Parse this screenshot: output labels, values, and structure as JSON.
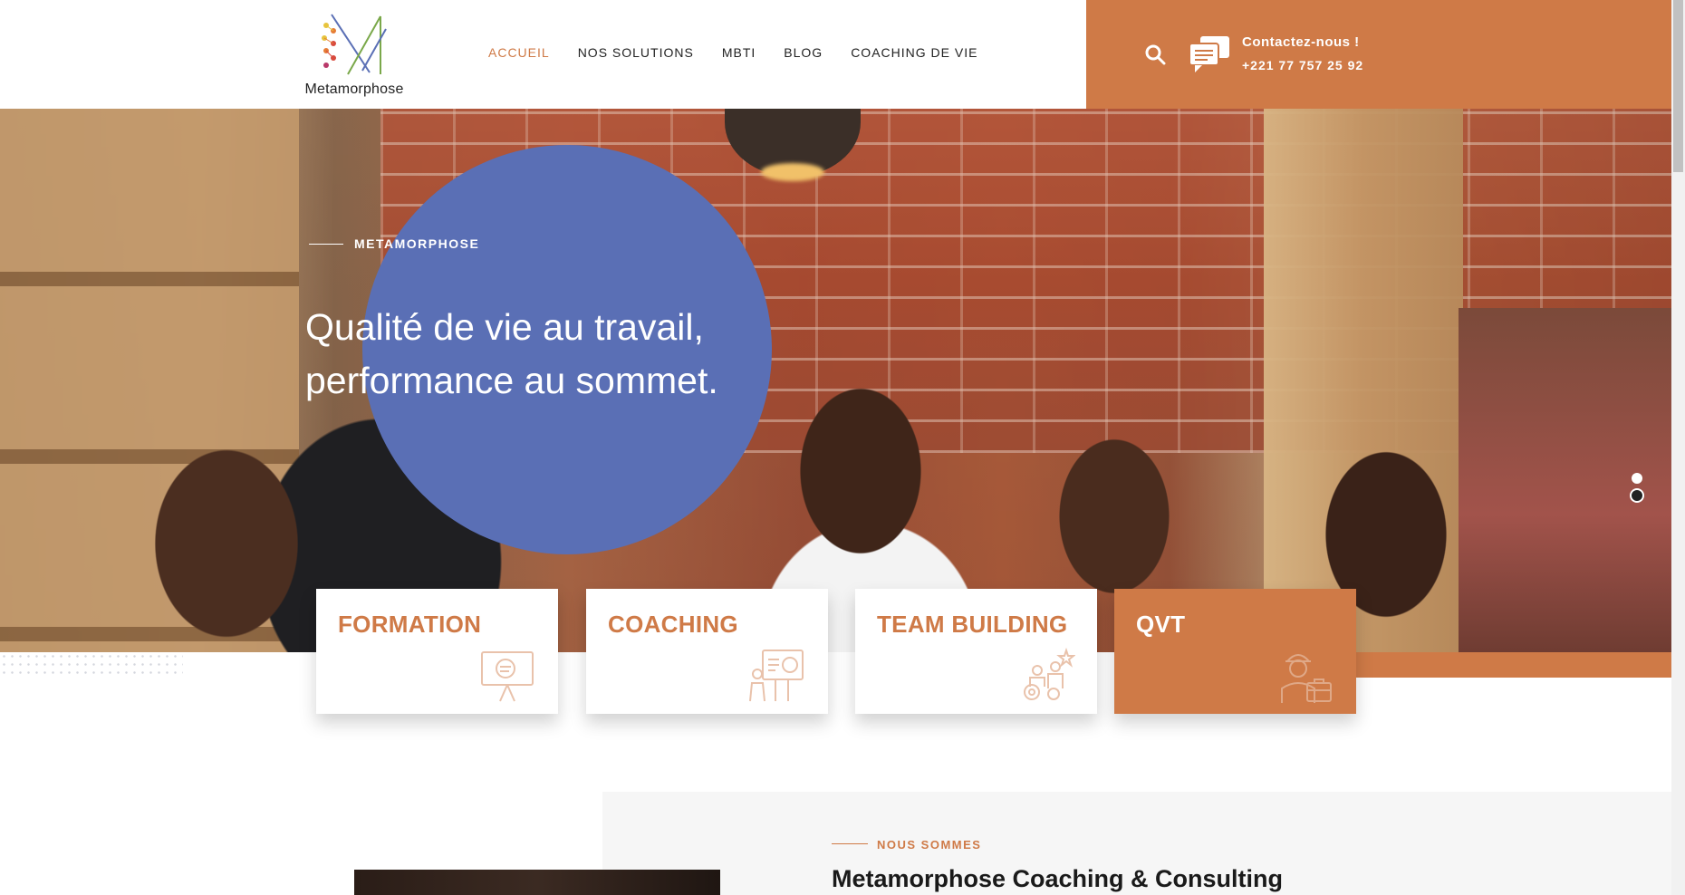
{
  "brand": {
    "logo_text": "Metamorphose",
    "accent_color": "#cf7a47",
    "circle_color": "#5a6fb5"
  },
  "nav": {
    "items": [
      {
        "label": "ACCUEIL",
        "active": true
      },
      {
        "label": "NOS SOLUTIONS",
        "active": false
      },
      {
        "label": "MBTI",
        "active": false
      },
      {
        "label": "BLOG",
        "active": false
      },
      {
        "label": "COACHING DE VIE",
        "active": false
      }
    ]
  },
  "contact": {
    "label": "Contactez-nous !",
    "phone": "+221 77 757 25 92",
    "icons": [
      "search-icon",
      "chat-icon"
    ]
  },
  "hero": {
    "eyebrow": "METAMORPHOSE",
    "title": "Qualité de vie au travail, performance au sommet.",
    "slides": 2,
    "active_slide": 1
  },
  "cards": [
    {
      "title": "FORMATION",
      "icon": "presentation-icon",
      "highlight": false
    },
    {
      "title": "COACHING",
      "icon": "coaching-board-icon",
      "highlight": false
    },
    {
      "title": "TEAM BUILDING",
      "icon": "team-gears-icon",
      "highlight": false
    },
    {
      "title": "QVT",
      "icon": "worker-briefcase-icon",
      "highlight": true
    }
  ],
  "about": {
    "eyebrow": "NOUS SOMMES",
    "title": "Metamorphose Coaching & Consulting"
  }
}
